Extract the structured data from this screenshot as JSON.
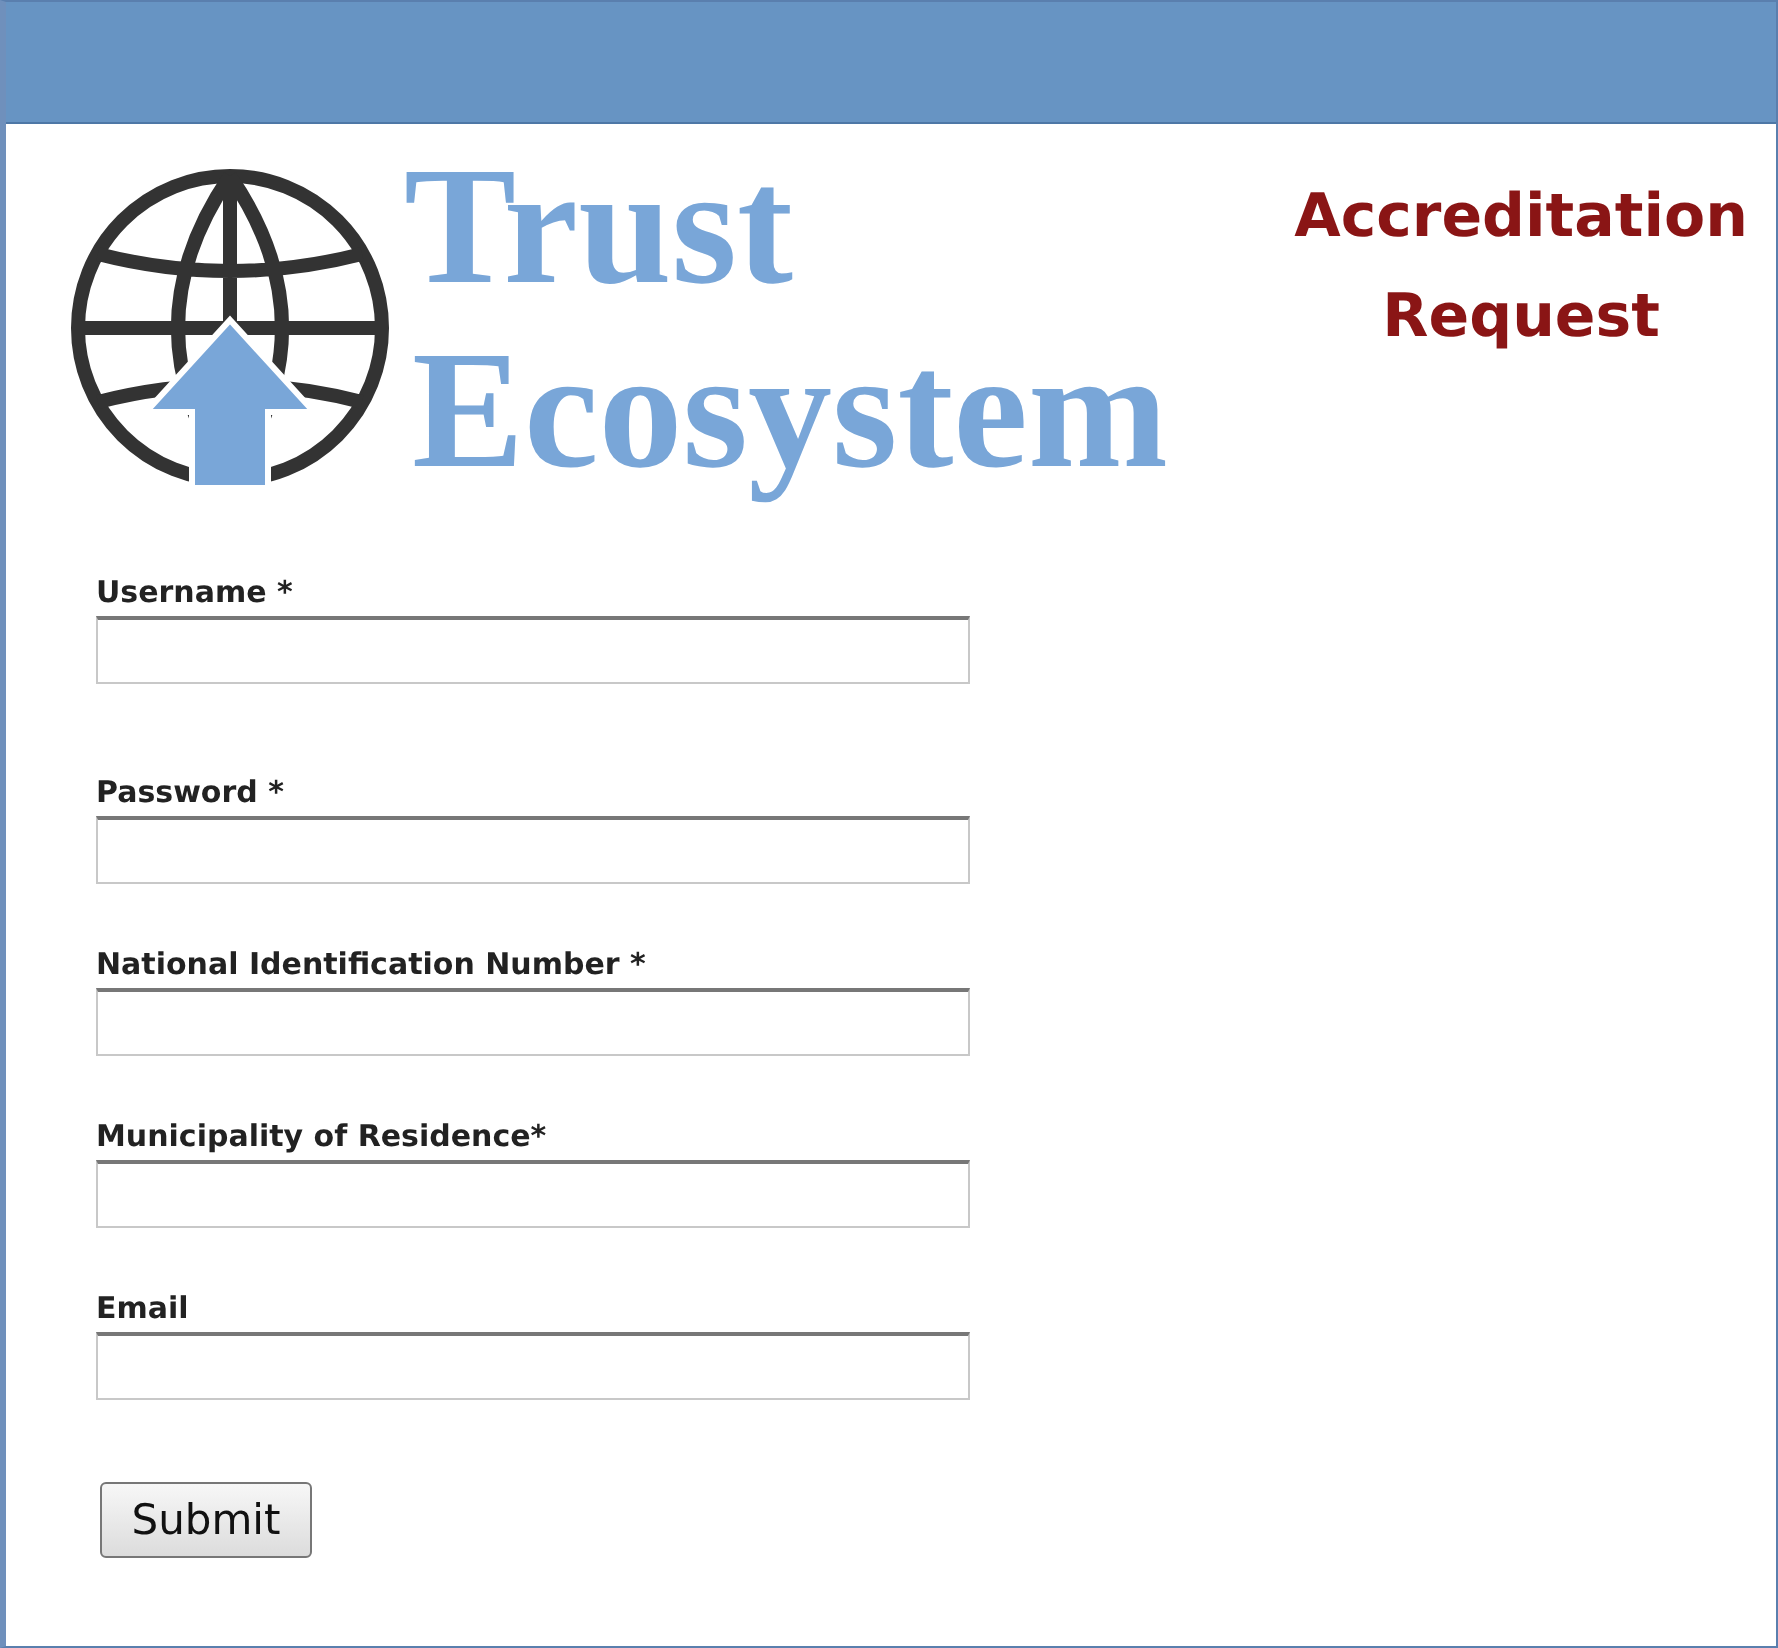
{
  "logo": {
    "line_1": "Trust",
    "line_2": "Ecosystem"
  },
  "page_title": [
    "Accreditation",
    "Request"
  ],
  "form": {
    "fields": [
      {
        "label": "Username *"
      },
      {
        "label": "Password *"
      },
      {
        "label": "National Identification Number *"
      },
      {
        "label": "Municipality of Residence*"
      },
      {
        "label": "Email"
      }
    ],
    "submit": "Submit"
  }
}
